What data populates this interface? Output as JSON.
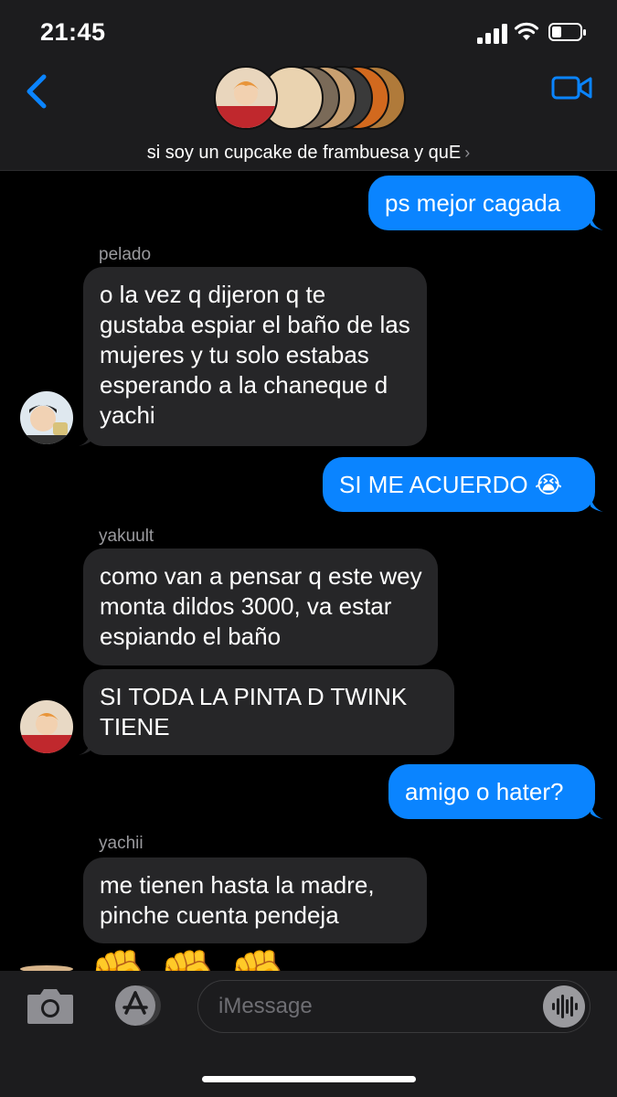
{
  "status_bar": {
    "time": "21:45"
  },
  "header": {
    "group_name": "si soy un cupcake de frambuesa y quE",
    "chevron": "›"
  },
  "messages": [
    {
      "side": "out",
      "text": "ps mejor cagada"
    },
    {
      "side": "in",
      "sender": "pelado",
      "text": "o la vez q dijeron q te gustaba espiar el baño de las mujeres y tu solo estabas esperando a la chaneque d yachi"
    },
    {
      "side": "out",
      "text": "SI ME ACUERDO 😭"
    },
    {
      "side": "in",
      "sender": "yakuult",
      "text": "como van a pensar q este wey monta dildos 3000, va estar espiando el baño"
    },
    {
      "side": "in",
      "text": "SI TODA LA PINTA D TWINK TIENE"
    },
    {
      "side": "out",
      "text": "amigo o hater?"
    },
    {
      "side": "in",
      "sender": "yachii",
      "text": "me tienen hasta la madre, pinche cuenta pendeja"
    },
    {
      "side": "in",
      "text": "✊✊✊"
    }
  ],
  "composer": {
    "placeholder": "iMessage"
  },
  "colors": {
    "outgoing": "#0a84ff",
    "incoming": "#262628",
    "accent": "#0a84ff"
  },
  "icons": [
    "back-chevron-icon",
    "video-camera-icon",
    "camera-icon",
    "app-store-icon",
    "audio-waveform-icon"
  ]
}
